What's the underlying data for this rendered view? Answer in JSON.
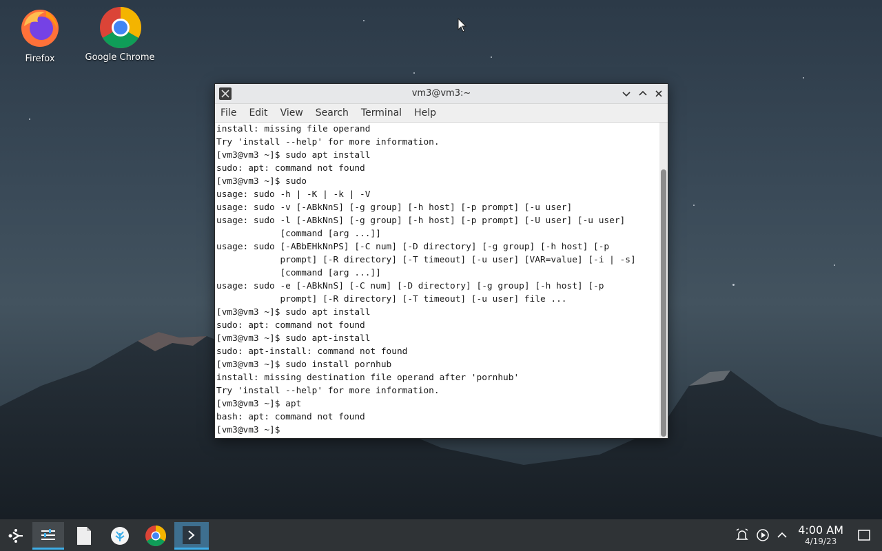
{
  "desktop": {
    "icons": [
      {
        "label": "Firefox"
      },
      {
        "label": "Google Chrome"
      }
    ]
  },
  "window": {
    "title": "vm3@vm3:~",
    "menu": [
      "File",
      "Edit",
      "View",
      "Search",
      "Terminal",
      "Help"
    ],
    "terminal_lines": [
      "install: missing file operand",
      "Try 'install --help' for more information.",
      "[vm3@vm3 ~]$ sudo apt install",
      "sudo: apt: command not found",
      "[vm3@vm3 ~]$ sudo",
      "usage: sudo -h | -K | -k | -V",
      "usage: sudo -v [-ABkNnS] [-g group] [-h host] [-p prompt] [-u user]",
      "usage: sudo -l [-ABkNnS] [-g group] [-h host] [-p prompt] [-U user] [-u user]",
      "            [command [arg ...]]",
      "usage: sudo [-ABbEHkNnPS] [-C num] [-D directory] [-g group] [-h host] [-p",
      "            prompt] [-R directory] [-T timeout] [-u user] [VAR=value] [-i | -s]",
      "            [command [arg ...]]",
      "usage: sudo -e [-ABkNnS] [-C num] [-D directory] [-g group] [-h host] [-p",
      "            prompt] [-R directory] [-T timeout] [-u user] file ...",
      "[vm3@vm3 ~]$ sudo apt install",
      "sudo: apt: command not found",
      "[vm3@vm3 ~]$ sudo apt-install",
      "sudo: apt-install: command not found",
      "[vm3@vm3 ~]$ sudo install pornhub",
      "install: missing destination file operand after 'pornhub'",
      "Try 'install --help' for more information.",
      "[vm3@vm3 ~]$ apt",
      "bash: apt: command not found",
      "[vm3@vm3 ~]$ "
    ]
  },
  "taskbar": {
    "time": "4:00 AM",
    "date": "4/19/23"
  },
  "colors": {
    "accent": "#3daee9",
    "taskbar": "#2f3336"
  }
}
